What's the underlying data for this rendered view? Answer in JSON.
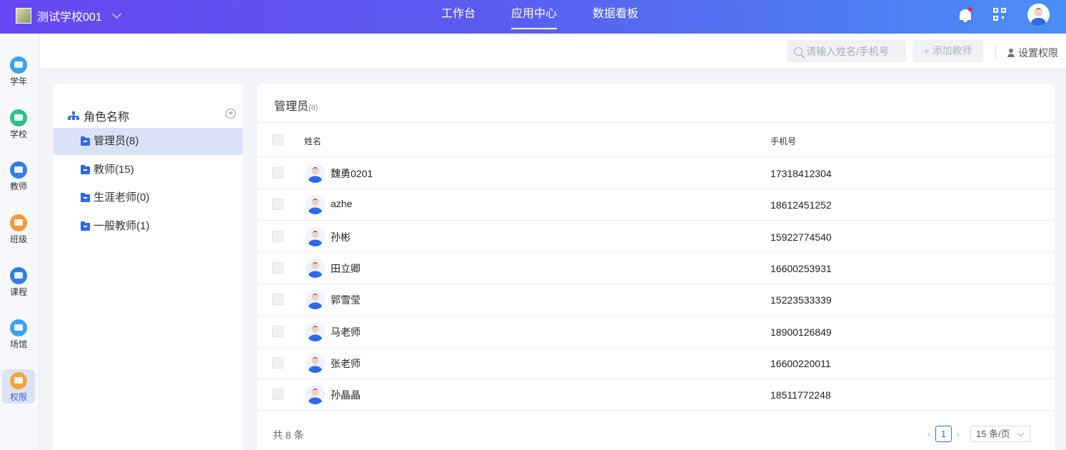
{
  "header": {
    "school_name": "测试学校001",
    "nav": [
      {
        "label": "工作台"
      },
      {
        "label": "应用中心"
      },
      {
        "label": "数据看板"
      }
    ]
  },
  "sidebar": {
    "items": [
      {
        "label": "学年",
        "color": "#3aa0f5"
      },
      {
        "label": "学校",
        "color": "#2fbf8a"
      },
      {
        "label": "教师",
        "color": "#2f7fe8"
      },
      {
        "label": "班级",
        "color": "#f59a3a"
      },
      {
        "label": "课程",
        "color": "#2f7fe8"
      },
      {
        "label": "场馆",
        "color": "#3aa0f5"
      },
      {
        "label": "权限",
        "color": "#f5a33a"
      }
    ]
  },
  "toolbar": {
    "search_placeholder": "请输入姓名/手机号",
    "add_teacher": "+ 添加教师",
    "set_permission": "设置权限"
  },
  "roles": {
    "header": "角色名称",
    "items": [
      {
        "label": "管理员(8)"
      },
      {
        "label": "教师(15)"
      },
      {
        "label": "生涯老师(0)"
      },
      {
        "label": "一般教师(1)"
      }
    ]
  },
  "table": {
    "title": "管理员",
    "title_count": "(8)",
    "col_name": "姓名",
    "col_phone": "手机号",
    "rows": [
      {
        "name": "魏勇0201",
        "phone": "17318412304"
      },
      {
        "name": "azhe",
        "phone": "18612451252"
      },
      {
        "name": "孙彬",
        "phone": "15922774540"
      },
      {
        "name": "田立卿",
        "phone": "16600253931"
      },
      {
        "name": "郭雪莹",
        "phone": "15223533339"
      },
      {
        "name": "马老师",
        "phone": "18900126849"
      },
      {
        "name": "张老师",
        "phone": "16600220011"
      },
      {
        "name": "孙晶晶",
        "phone": "18511772248"
      }
    ],
    "total": "共 8 条",
    "page": "1",
    "page_size": "15 条/页"
  },
  "colors": {
    "accent": "#3a6fdc",
    "header_start": "#6747f2",
    "header_end": "#4a8ff5"
  }
}
